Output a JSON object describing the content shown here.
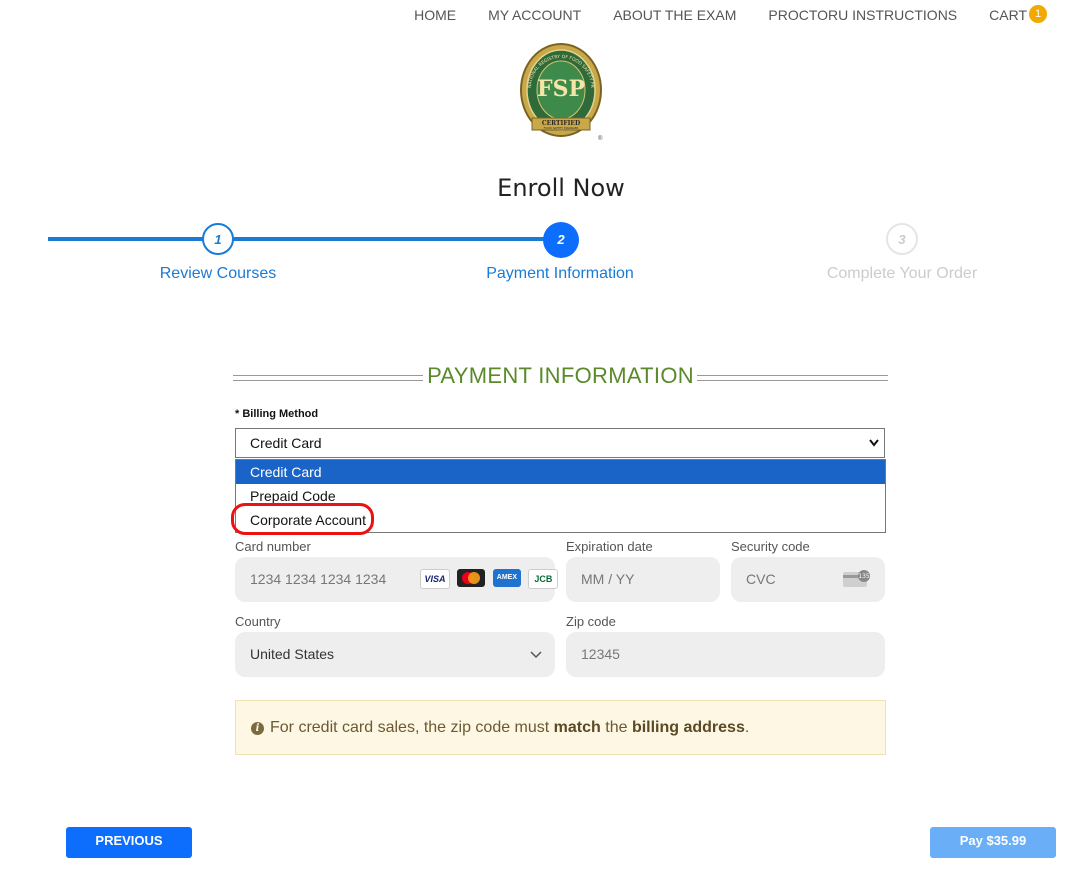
{
  "nav": {
    "home": "HOME",
    "my_account": "MY ACCOUNT",
    "about_exam": "ABOUT THE EXAM",
    "proctoru": "PROCTORU INSTRUCTIONS",
    "cart": "CART",
    "cart_count": "1"
  },
  "logo": {
    "letters": "FSP",
    "ring_text": "NATIONAL REGISTRY OF FOOD SAFETY PROFESSIONALS",
    "banner": "CERTIFIED",
    "sub_banner": "FOOD SAFETY MANAGER",
    "registered": "®"
  },
  "page_title": "Enroll Now",
  "steps": [
    {
      "number": "1",
      "label": "Review Courses",
      "state": "done"
    },
    {
      "number": "2",
      "label": "Payment Information",
      "state": "active"
    },
    {
      "number": "3",
      "label": "Complete Your Order",
      "state": "pending"
    }
  ],
  "section_title": "PAYMENT INFORMATION",
  "billing": {
    "label": "* Billing Method",
    "selected": "Credit Card",
    "options": [
      "Credit Card",
      "Prepaid Code",
      "Corporate Account"
    ]
  },
  "card": {
    "number_label": "Card number",
    "number_placeholder": "1234 1234 1234 1234",
    "expiry_label": "Expiration date",
    "expiry_placeholder": "MM / YY",
    "cvc_label": "Security code",
    "cvc_placeholder": "CVC",
    "brands": [
      "VISA",
      "mastercard-icon",
      "amex-icon",
      "jcb-icon"
    ],
    "visa": "VISA",
    "amex": "AMEX",
    "jcb": "JCB",
    "cvc_digits": "135"
  },
  "address": {
    "country_label": "Country",
    "country_value": "United States",
    "zip_label": "Zip code",
    "zip_placeholder": "12345"
  },
  "notice": {
    "pre": "For credit card sales, the zip code must ",
    "bold1": "match",
    "mid": " the ",
    "bold2": "billing address",
    "post": "."
  },
  "buttons": {
    "previous": "PREVIOUS",
    "pay": "Pay $35.99"
  },
  "colors": {
    "primary": "#1a7bd6",
    "green_heading": "#5a8a2b",
    "highlight_red": "#ee1111",
    "cart_badge": "#f2a900"
  }
}
